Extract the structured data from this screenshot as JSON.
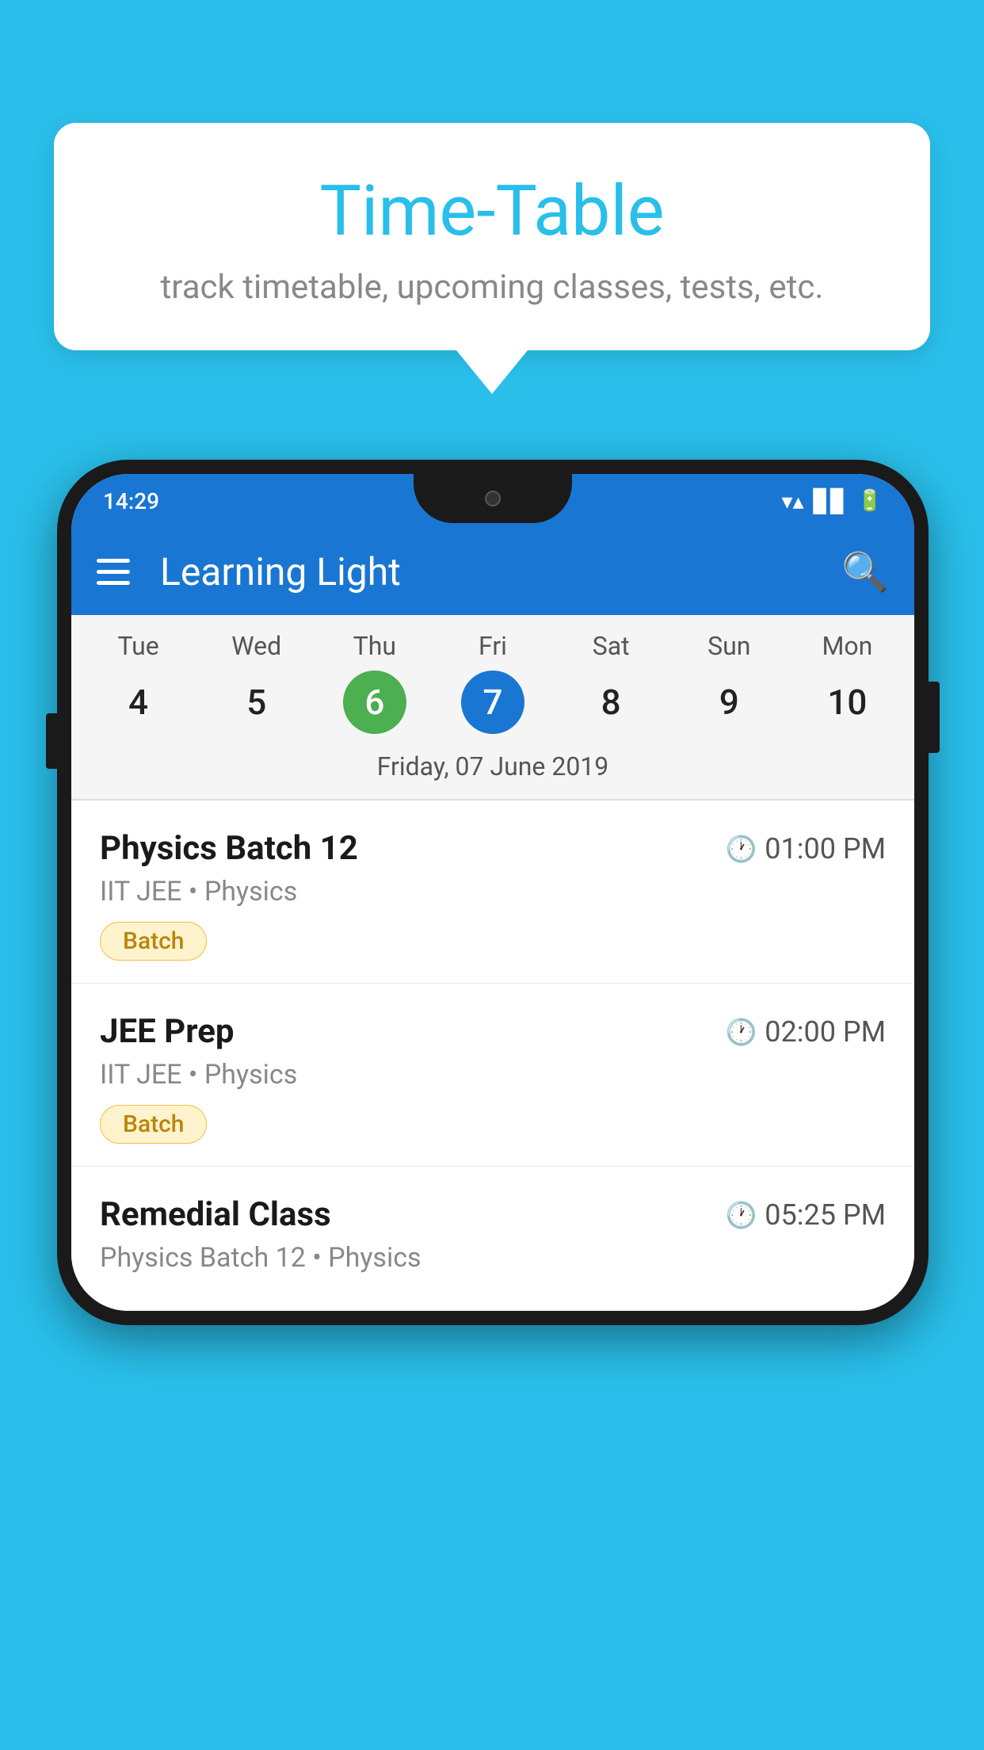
{
  "background_color": "#29BFEA",
  "speech_bubble": {
    "title": "Time-Table",
    "subtitle": "track timetable, upcoming classes, tests, etc."
  },
  "phone": {
    "status_bar": {
      "time": "14:29"
    },
    "app_bar": {
      "title": "Learning Light"
    },
    "calendar": {
      "days": [
        {
          "name": "Tue",
          "num": "4",
          "state": "normal"
        },
        {
          "name": "Wed",
          "num": "5",
          "state": "normal"
        },
        {
          "name": "Thu",
          "num": "6",
          "state": "today"
        },
        {
          "name": "Fri",
          "num": "7",
          "state": "selected"
        },
        {
          "name": "Sat",
          "num": "8",
          "state": "normal"
        },
        {
          "name": "Sun",
          "num": "9",
          "state": "normal"
        },
        {
          "name": "Mon",
          "num": "10",
          "state": "normal"
        }
      ],
      "selected_date_label": "Friday, 07 June 2019"
    },
    "schedule": [
      {
        "name": "Physics Batch 12",
        "time": "01:00 PM",
        "sub": "IIT JEE • Physics",
        "tag": "Batch"
      },
      {
        "name": "JEE Prep",
        "time": "02:00 PM",
        "sub": "IIT JEE • Physics",
        "tag": "Batch"
      },
      {
        "name": "Remedial Class",
        "time": "05:25 PM",
        "sub": "Physics Batch 12 • Physics",
        "tag": null
      }
    ]
  }
}
